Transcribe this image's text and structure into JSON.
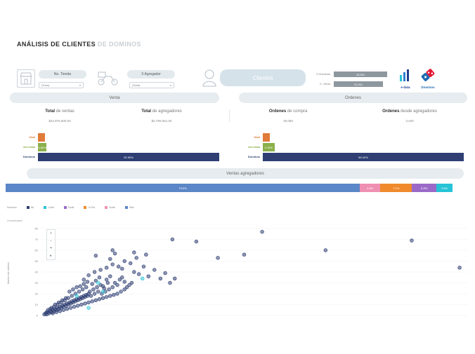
{
  "header": {
    "title_main": "ANÁLISIS DE CLIENTES",
    "title_sub": "DE DOMINOS"
  },
  "filters": {
    "store_label": "No. Tienda",
    "store_value": "(Todo)",
    "aggregator_label": "X Agregador",
    "aggregator_value": "(Todo)"
  },
  "clientes_button": "Clientes",
  "counts": {
    "rows": [
      {
        "label": "C.Dominos",
        "value": "33,551"
      },
      {
        "label": "C. Otros",
        "value": "31,001"
      }
    ]
  },
  "logos": {
    "left": "e-data",
    "right": "Dominos"
  },
  "sections": {
    "ventas": "Venta",
    "ordenes": "Ordenes",
    "ventas_agregadores": "Ventas agregadores"
  },
  "kpis": {
    "total_ventas_bold": "Total",
    "total_ventas_rest": " de ventas",
    "total_ventas_value": "$34,976,500.00",
    "total_agregadores_bold": "Total",
    "total_agregadores_rest": " de agregadores",
    "total_agregadores_value": "$2,790,051.00",
    "ordenes_compra_bold": "Ordenes",
    "ordenes_compra_rest": " de compra",
    "ordenes_compra_value": "39,058",
    "ordenes_agregadores_bold": "Ordenes",
    "ordenes_agregadores_rest": " desde agregadores",
    "ordenes_agregadores_value": "3,493"
  },
  "ventas_bars": [
    {
      "label": "Ubal",
      "value": "",
      "pct": 2.5,
      "color": "#e07b39"
    },
    {
      "label": "dex-Data",
      "value": "4.60%",
      "pct": 4.6,
      "color": "#8bb04a"
    },
    {
      "label": "Dominos",
      "value": "92.90%",
      "pct": 100,
      "color": "#2f3f73"
    }
  ],
  "ordenes_bars": [
    {
      "label": "Ubal",
      "value": "",
      "pct": 2.5,
      "color": "#e07b39"
    },
    {
      "label": "dex-Data",
      "value": "5.78%",
      "pct": 5.8,
      "color": "#8bb04a"
    },
    {
      "label": "Dominos",
      "value": "89.42%",
      "pct": 100,
      "color": "#2f3f73"
    }
  ],
  "stacked": [
    {
      "label": "79.5%",
      "pct": 79.5,
      "color": "#5b86c7"
    },
    {
      "label": "4.6%",
      "pct": 4.6,
      "color": "#ef8fb2"
    },
    {
      "label": "7.1%",
      "pct": 7.1,
      "color": "#f08a2c"
    },
    {
      "label": "5.5%",
      "pct": 5.5,
      "color": "#9b6ac8"
    },
    {
      "label": "3.6%",
      "pct": 3.6,
      "color": "#27c3d6"
    }
  ],
  "legend": {
    "title": "Dominos",
    "items": [
      {
        "label": "Nb",
        "color": "#2f3f73"
      },
      {
        "label": "Lolita",
        "color": "#27c3d6"
      },
      {
        "label": "Sodik",
        "color": "#9b6ac8"
      },
      {
        "label": "Ur Ekt",
        "color": "#f08a2c"
      },
      {
        "label": "Sodik",
        "color": "#ef8fb2"
      },
      {
        "label": "Stile",
        "color": "#5b86c7"
      }
    ]
  },
  "chart_data": {
    "type": "scatter",
    "title": "Comunicación",
    "xlabel": "",
    "ylabel": "Numero de ordenes",
    "ylim": [
      0,
      80
    ],
    "yticks": [
      "0",
      "10",
      "20",
      "30",
      "40",
      "50",
      "60",
      "70",
      "80"
    ],
    "series": [
      {
        "color": "#2f3f73",
        "points": [
          [
            3,
            1
          ],
          [
            4,
            2
          ],
          [
            5,
            1
          ],
          [
            6,
            3
          ],
          [
            7,
            2
          ],
          [
            8,
            4
          ],
          [
            9,
            3
          ],
          [
            10,
            5
          ],
          [
            11,
            4
          ],
          [
            12,
            6
          ],
          [
            13,
            5
          ],
          [
            14,
            7
          ],
          [
            15,
            6
          ],
          [
            16,
            8
          ],
          [
            17,
            7
          ],
          [
            18,
            9
          ],
          [
            19,
            8
          ],
          [
            20,
            10
          ],
          [
            21,
            9
          ],
          [
            22,
            11
          ],
          [
            23,
            10
          ],
          [
            24,
            12
          ],
          [
            25,
            11
          ],
          [
            26,
            13
          ],
          [
            27,
            12
          ],
          [
            28,
            14
          ],
          [
            29,
            13
          ],
          [
            30,
            15
          ],
          [
            31,
            14
          ],
          [
            32,
            16
          ],
          [
            33,
            15
          ],
          [
            34,
            17
          ],
          [
            35,
            16
          ],
          [
            36,
            18
          ],
          [
            37,
            17
          ],
          [
            38,
            19
          ],
          [
            39,
            18
          ],
          [
            40,
            20
          ],
          [
            5,
            3
          ],
          [
            8,
            6
          ],
          [
            11,
            8
          ],
          [
            14,
            10
          ],
          [
            17,
            12
          ],
          [
            20,
            14
          ],
          [
            23,
            16
          ],
          [
            26,
            18
          ],
          [
            29,
            20
          ],
          [
            32,
            22
          ],
          [
            35,
            24
          ],
          [
            38,
            26
          ],
          [
            41,
            22
          ],
          [
            44,
            24
          ],
          [
            47,
            26
          ],
          [
            50,
            28
          ],
          [
            53,
            25
          ],
          [
            56,
            30
          ],
          [
            43,
            29
          ],
          [
            46,
            32
          ],
          [
            49,
            35
          ],
          [
            52,
            27
          ],
          [
            55,
            33
          ],
          [
            58,
            36
          ],
          [
            42,
            18
          ],
          [
            45,
            20
          ],
          [
            48,
            22
          ],
          [
            51,
            20
          ],
          [
            54,
            22
          ],
          [
            57,
            24
          ],
          [
            60,
            26
          ],
          [
            62,
            30
          ],
          [
            64,
            28
          ],
          [
            66,
            33
          ],
          [
            68,
            35
          ],
          [
            70,
            31
          ],
          [
            10,
            2
          ],
          [
            13,
            3
          ],
          [
            16,
            4
          ],
          [
            19,
            5
          ],
          [
            22,
            6
          ],
          [
            25,
            7
          ],
          [
            28,
            8
          ],
          [
            31,
            9
          ],
          [
            34,
            10
          ],
          [
            37,
            11
          ],
          [
            40,
            12
          ],
          [
            43,
            13
          ],
          [
            46,
            14
          ],
          [
            49,
            15
          ],
          [
            52,
            16
          ],
          [
            55,
            17
          ],
          [
            58,
            18
          ],
          [
            61,
            19
          ],
          [
            64,
            20
          ],
          [
            67,
            22
          ],
          [
            70,
            24
          ],
          [
            72,
            26
          ],
          [
            74,
            28
          ],
          [
            76,
            30
          ],
          [
            36,
            33
          ],
          [
            40,
            37
          ],
          [
            45,
            40
          ],
          [
            50,
            42
          ],
          [
            55,
            44
          ],
          [
            60,
            47
          ],
          [
            65,
            45
          ],
          [
            70,
            50
          ],
          [
            75,
            48
          ],
          [
            80,
            53
          ],
          [
            62,
            57
          ],
          [
            58,
            52
          ],
          [
            68,
            43
          ],
          [
            78,
            40
          ],
          [
            82,
            38
          ],
          [
            86,
            45
          ],
          [
            90,
            36
          ],
          [
            95,
            42
          ],
          [
            100,
            34
          ],
          [
            104,
            39
          ],
          [
            108,
            30
          ],
          [
            112,
            34
          ],
          [
            88,
            56
          ],
          [
            46,
            55
          ],
          [
            60,
            60
          ],
          [
            78,
            58
          ],
          [
            110,
            70
          ],
          [
            148,
            53
          ],
          [
            130,
            68
          ],
          [
            170,
            56
          ],
          [
            185,
            77
          ],
          [
            238,
            60
          ],
          [
            310,
            69
          ],
          [
            350,
            44
          ],
          [
            24,
            22
          ],
          [
            27,
            24
          ],
          [
            30,
            26
          ],
          [
            33,
            27
          ],
          [
            36,
            29
          ],
          [
            39,
            31
          ],
          [
            12,
            10
          ],
          [
            15,
            12
          ],
          [
            18,
            14
          ],
          [
            21,
            16
          ],
          [
            6,
            5
          ],
          [
            9,
            7
          ]
        ]
      },
      {
        "color": "#27c3d6",
        "points": [
          [
            30,
            18
          ],
          [
            48,
            30
          ],
          [
            40,
            7
          ],
          [
            52,
            22
          ],
          [
            85,
            34
          ]
        ]
      }
    ]
  }
}
